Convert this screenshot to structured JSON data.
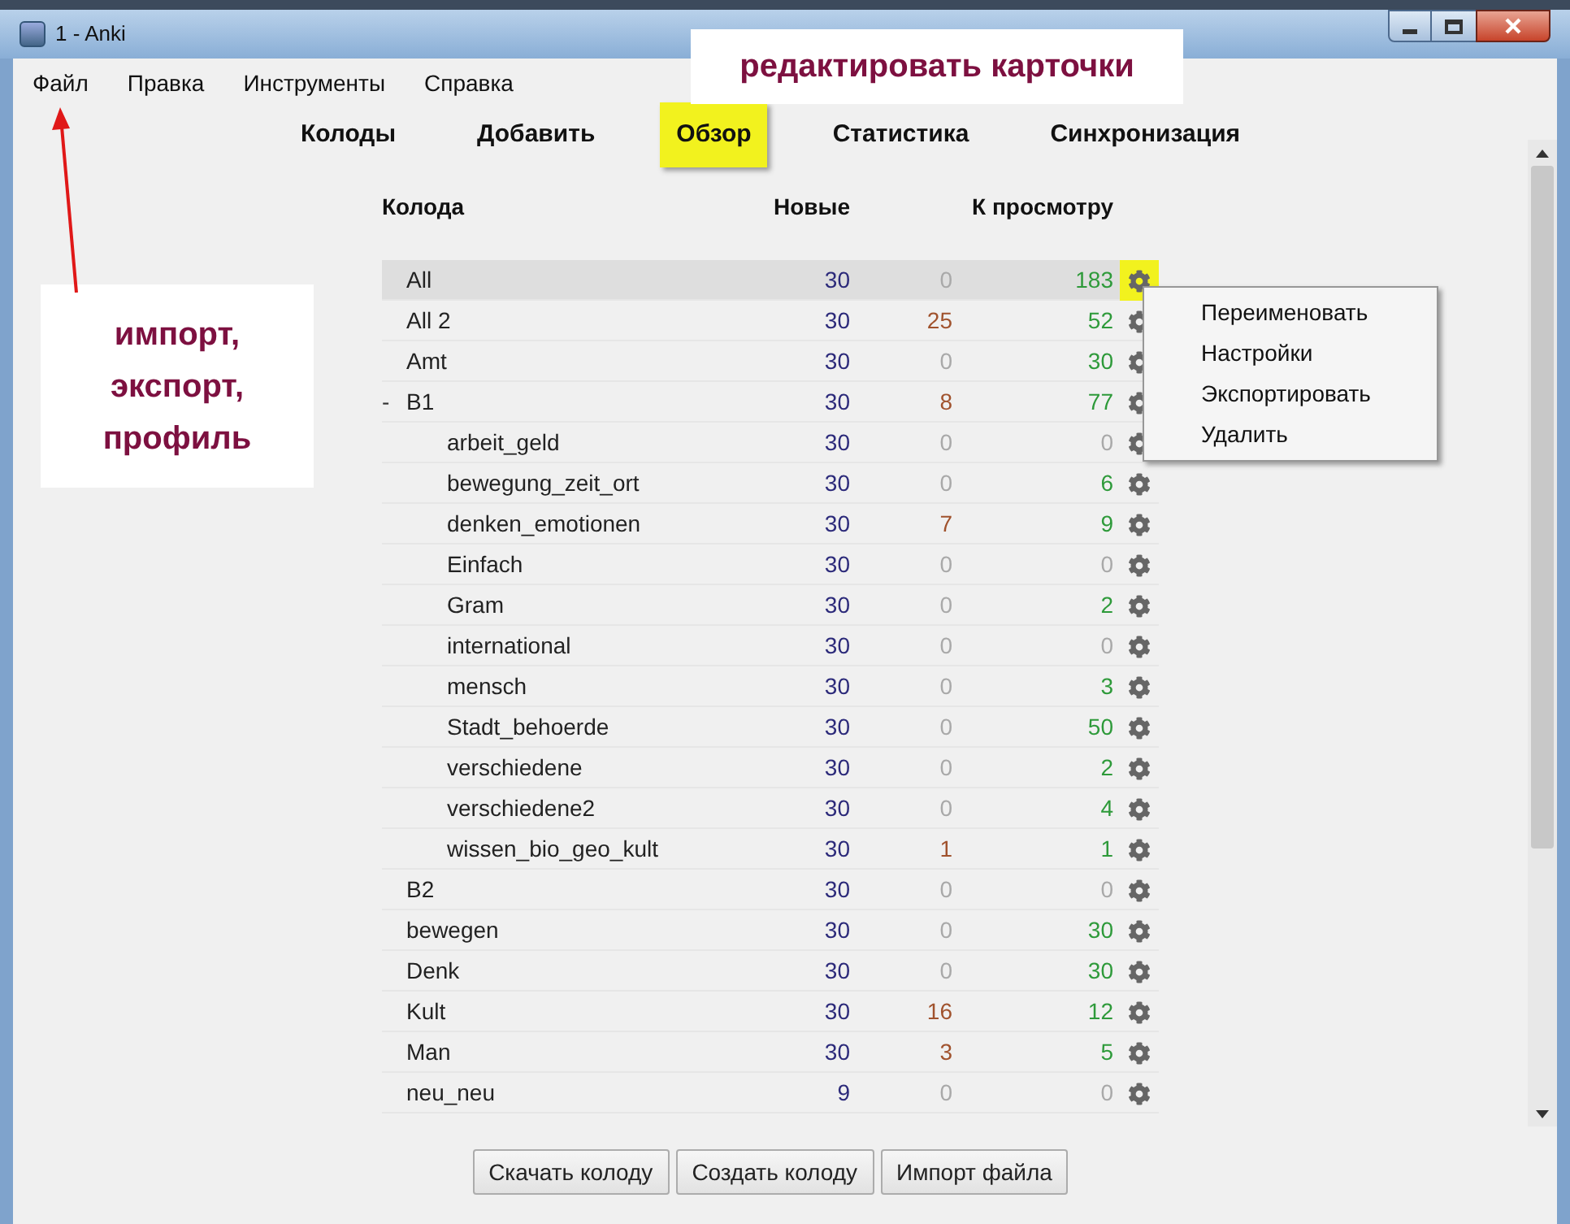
{
  "window": {
    "title": "1 - Anki"
  },
  "menu": [
    "Файл",
    "Правка",
    "Инструменты",
    "Справка"
  ],
  "tabs": [
    {
      "label": "Колоды",
      "selected": false,
      "highlighted": false
    },
    {
      "label": "Добавить",
      "selected": false,
      "highlighted": false
    },
    {
      "label": "Обзор",
      "selected": false,
      "highlighted": true
    },
    {
      "label": "Статистика",
      "selected": false,
      "highlighted": false
    },
    {
      "label": "Синхронизация",
      "selected": false,
      "highlighted": false
    }
  ],
  "table": {
    "columns": [
      "Колода",
      "Новые",
      "К просмотру"
    ],
    "decks": [
      {
        "name": "All",
        "new": "30",
        "learn": {
          "text": "0",
          "dim": true
        },
        "due": {
          "text": "183",
          "dim": false
        },
        "selected": true,
        "highlighted": true
      },
      {
        "name": "All 2",
        "new": "30",
        "learn": {
          "text": "25",
          "dim": false
        },
        "due": {
          "text": "52",
          "dim": false
        },
        "selected": false,
        "highlighted": false
      },
      {
        "name": "Amt",
        "new": "30",
        "learn": {
          "text": "0",
          "dim": true
        },
        "due": {
          "text": "30",
          "dim": false
        },
        "selected": false,
        "highlighted": false
      },
      {
        "name": "B1",
        "toggle": "-",
        "new": "30",
        "learn": {
          "text": "8",
          "dim": false
        },
        "due": {
          "text": "77",
          "dim": false
        },
        "selected": false,
        "highlighted": false,
        "children": [
          {
            "name": "arbeit_geld",
            "new": "30",
            "learn": {
              "text": "0",
              "dim": true
            },
            "due": {
              "text": "0",
              "dim": true
            },
            "selected": false,
            "highlighted": false
          },
          {
            "name": "bewegung_zeit_ort",
            "new": "30",
            "learn": {
              "text": "0",
              "dim": true
            },
            "due": {
              "text": "6",
              "dim": false
            },
            "selected": false,
            "highlighted": false
          },
          {
            "name": "denken_emotionen",
            "new": "30",
            "learn": {
              "text": "7",
              "dim": false
            },
            "due": {
              "text": "9",
              "dim": false
            },
            "selected": false,
            "highlighted": false
          },
          {
            "name": "Einfach",
            "new": "30",
            "learn": {
              "text": "0",
              "dim": true
            },
            "due": {
              "text": "0",
              "dim": true
            },
            "selected": false,
            "highlighted": false
          },
          {
            "name": "Gram",
            "new": "30",
            "learn": {
              "text": "0",
              "dim": true
            },
            "due": {
              "text": "2",
              "dim": false
            },
            "selected": false,
            "highlighted": false
          },
          {
            "name": "international",
            "new": "30",
            "learn": {
              "text": "0",
              "dim": true
            },
            "due": {
              "text": "0",
              "dim": true
            },
            "selected": false,
            "highlighted": false
          },
          {
            "name": "mensch",
            "new": "30",
            "learn": {
              "text": "0",
              "dim": true
            },
            "due": {
              "text": "3",
              "dim": false
            },
            "selected": false,
            "highlighted": false
          },
          {
            "name": "Stadt_behoerde",
            "new": "30",
            "learn": {
              "text": "0",
              "dim": true
            },
            "due": {
              "text": "50",
              "dim": false
            },
            "selected": false,
            "highlighted": false
          },
          {
            "name": "verschiedene",
            "new": "30",
            "learn": {
              "text": "0",
              "dim": true
            },
            "due": {
              "text": "2",
              "dim": false
            },
            "selected": false,
            "highlighted": false
          },
          {
            "name": "verschiedene2",
            "new": "30",
            "learn": {
              "text": "0",
              "dim": true
            },
            "due": {
              "text": "4",
              "dim": false
            },
            "selected": false,
            "highlighted": false
          },
          {
            "name": "wissen_bio_geo_kult",
            "new": "30",
            "learn": {
              "text": "1",
              "dim": false
            },
            "due": {
              "text": "1",
              "dim": false
            },
            "selected": false,
            "highlighted": false
          }
        ]
      },
      {
        "name": "B2",
        "new": "30",
        "learn": {
          "text": "0",
          "dim": true
        },
        "due": {
          "text": "0",
          "dim": true
        },
        "selected": false,
        "highlighted": false
      },
      {
        "name": "bewegen",
        "new": "30",
        "learn": {
          "text": "0",
          "dim": true
        },
        "due": {
          "text": "30",
          "dim": false
        },
        "selected": false,
        "highlighted": false
      },
      {
        "name": "Denk",
        "new": "30",
        "learn": {
          "text": "0",
          "dim": true
        },
        "due": {
          "text": "30",
          "dim": false
        },
        "selected": false,
        "highlighted": false
      },
      {
        "name": "Kult",
        "new": "30",
        "learn": {
          "text": "16",
          "dim": false
        },
        "due": {
          "text": "12",
          "dim": false
        },
        "selected": false,
        "highlighted": false
      },
      {
        "name": "Man",
        "new": "30",
        "learn": {
          "text": "3",
          "dim": false
        },
        "due": {
          "text": "5",
          "dim": false
        },
        "selected": false,
        "highlighted": false
      },
      {
        "name": "neu_neu",
        "new": "9",
        "learn": {
          "text": "0",
          "dim": true
        },
        "due": {
          "text": "0",
          "dim": true
        },
        "selected": false,
        "highlighted": false
      }
    ]
  },
  "context_menu": [
    "Переименовать",
    "Настройки",
    "Экспортировать",
    "Удалить"
  ],
  "buttons": [
    "Скачать колоду",
    "Создать колоду",
    "Импорт файла"
  ],
  "annotations": {
    "top_callout": "редактировать карточки",
    "left_callout": "импорт,\nэкспорт,\nпрофиль"
  }
}
